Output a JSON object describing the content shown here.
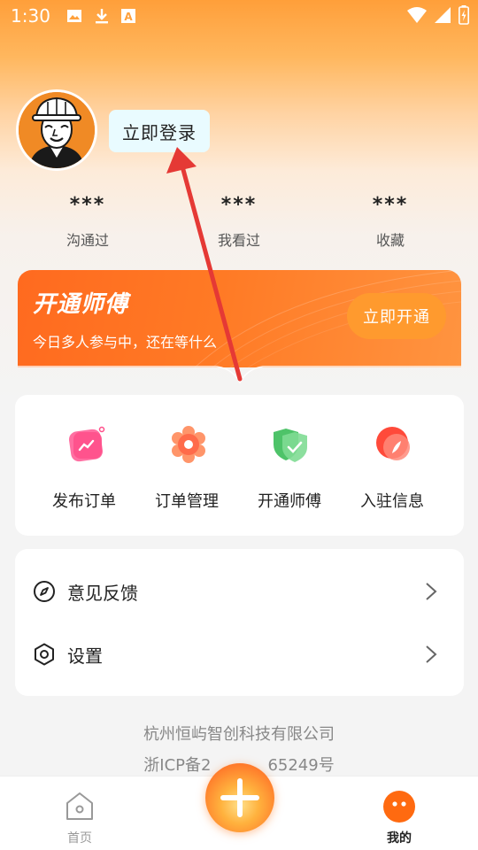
{
  "status_bar": {
    "time": "1:30",
    "icons_left": [
      "image-icon",
      "download-icon",
      "font-a-icon"
    ],
    "icons_right": [
      "wifi-icon",
      "signal-icon",
      "battery-icon"
    ]
  },
  "profile": {
    "avatar": "worker-avatar",
    "login_label": "立即登录"
  },
  "stats": [
    {
      "value": "***",
      "label": "沟通过"
    },
    {
      "value": "***",
      "label": "我看过"
    },
    {
      "value": "***",
      "label": "收藏"
    }
  ],
  "vip": {
    "title": "开通师傅",
    "subtitle": "今日多人参与中，还在等什么",
    "button": "立即开通"
  },
  "functions": [
    {
      "label": "发布订单",
      "icon": "publish-order-icon",
      "color": "#ff4f8a"
    },
    {
      "label": "订单管理",
      "icon": "order-manage-icon",
      "color": "#ff6b4a"
    },
    {
      "label": "开通师傅",
      "icon": "shield-check-icon",
      "color": "#35c25a"
    },
    {
      "label": "入驻信息",
      "icon": "join-info-icon",
      "color": "#ff4a3a"
    }
  ],
  "menu": [
    {
      "label": "意见反馈",
      "icon": "compass-icon"
    },
    {
      "label": "设置",
      "icon": "hexagon-settings-icon"
    }
  ],
  "footer": {
    "company": "杭州恒屿智创科技有限公司",
    "icp_left": "浙ICP备2",
    "icp_right": "65249号"
  },
  "tabbar": {
    "home_label": "首页",
    "mine_label": "我的",
    "add_icon": "plus-icon",
    "active_color": "#ff6a10"
  }
}
